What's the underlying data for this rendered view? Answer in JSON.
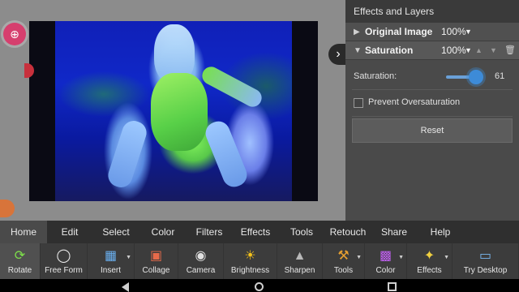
{
  "canvas": {
    "zoom_icon": "zoom-in-icon",
    "collapse_icon": "chevron-right-icon"
  },
  "panel": {
    "title": "Effects and Layers",
    "layers": [
      {
        "name": "Original Image",
        "opacity": "100%",
        "expanded": false
      },
      {
        "name": "Saturation",
        "opacity": "100%",
        "expanded": true
      }
    ],
    "saturation": {
      "label": "Saturation:",
      "value": "61"
    },
    "prevent_oversaturation": {
      "label": "Prevent Oversaturation",
      "checked": false
    },
    "reset_label": "Reset"
  },
  "menu": [
    "Home",
    "Edit",
    "Select",
    "Color",
    "Filters",
    "Effects",
    "Tools",
    "Retouch",
    "Share",
    "Help"
  ],
  "menu_active": "Home",
  "toolbar": [
    {
      "label": "Rotate",
      "icon": "rotate-icon"
    },
    {
      "label": "Free Form",
      "icon": "free-form-icon"
    },
    {
      "label": "Insert",
      "icon": "insert-icon"
    },
    {
      "label": "Collage",
      "icon": "collage-icon"
    },
    {
      "label": "Camera",
      "icon": "camera-icon"
    },
    {
      "label": "Brightness",
      "icon": "brightness-icon"
    },
    {
      "label": "Sharpen",
      "icon": "sharpen-icon"
    },
    {
      "label": "Tools",
      "icon": "tools-icon"
    },
    {
      "label": "Color",
      "icon": "color-icon"
    },
    {
      "label": "Effects",
      "icon": "effects-icon"
    },
    {
      "label": "Try Desktop",
      "icon": "desktop-icon"
    }
  ],
  "colors": {
    "accent": "#3d8bd8",
    "zoom_button": "#d63f6e"
  }
}
